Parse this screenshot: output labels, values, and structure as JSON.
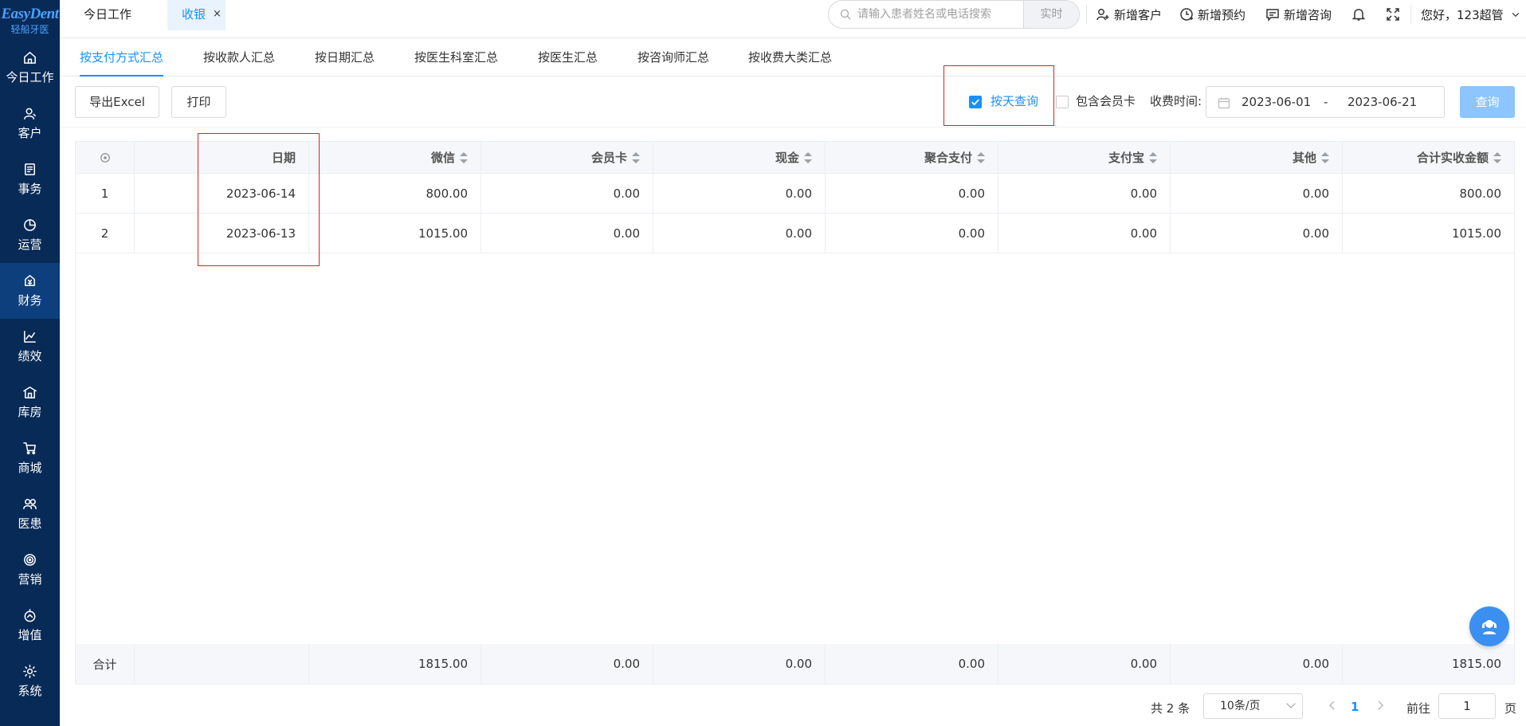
{
  "logo": {
    "main": "EasyDent",
    "sub": "轻船牙医"
  },
  "sidebar": {
    "items": [
      {
        "label": "今日工作",
        "icon": "home-icon"
      },
      {
        "label": "客户",
        "icon": "user-icon"
      },
      {
        "label": "事务",
        "icon": "clipboard-icon"
      },
      {
        "label": "运营",
        "icon": "pie-chart-icon"
      },
      {
        "label": "财务",
        "icon": "finance-icon"
      },
      {
        "label": "绩效",
        "icon": "line-chart-icon"
      },
      {
        "label": "库房",
        "icon": "warehouse-icon"
      },
      {
        "label": "商城",
        "icon": "cart-icon"
      },
      {
        "label": "医患",
        "icon": "people-icon"
      },
      {
        "label": "营销",
        "icon": "target-icon"
      },
      {
        "label": "增值",
        "icon": "growth-icon"
      },
      {
        "label": "系统",
        "icon": "gear-icon"
      }
    ],
    "active_index": 4
  },
  "topbar": {
    "tab_today": "今日工作",
    "tab_cash": "收银",
    "tab_close": "×",
    "search_placeholder": "请输入患者姓名或电话搜索",
    "realtime": "实时",
    "new_customer": "新增客户",
    "new_appointment": "新增预约",
    "new_consult": "新增咨询",
    "greeting": "您好，123超管"
  },
  "summary_tabs": [
    "按支付方式汇总",
    "按收款人汇总",
    "按日期汇总",
    "按医生科室汇总",
    "按医生汇总",
    "按咨询师汇总",
    "按收费大类汇总"
  ],
  "toolbar": {
    "export": "导出Excel",
    "print": "打印",
    "by_day": "按天查询",
    "by_day_checked": true,
    "include_member": "包含会员卡",
    "include_member_checked": false,
    "time_label": "收费时间:",
    "date_start": "2023-06-01",
    "date_sep": "-",
    "date_end": "2023-06-21",
    "query": "查询"
  },
  "table": {
    "columns": [
      "日期",
      "微信",
      "会员卡",
      "现金",
      "聚合支付",
      "支付宝",
      "其他",
      "合计实收金额"
    ],
    "rows": [
      {
        "idx": "1",
        "date": "2023-06-14",
        "wechat": "800.00",
        "member": "0.00",
        "cash": "0.00",
        "agg": "0.00",
        "alipay": "0.00",
        "other": "0.00",
        "total": "800.00"
      },
      {
        "idx": "2",
        "date": "2023-06-13",
        "wechat": "1015.00",
        "member": "0.00",
        "cash": "0.00",
        "agg": "0.00",
        "alipay": "0.00",
        "other": "0.00",
        "total": "1015.00"
      }
    ],
    "footer": {
      "label": "合计",
      "wechat": "1815.00",
      "member": "0.00",
      "cash": "0.00",
      "agg": "0.00",
      "alipay": "0.00",
      "other": "0.00",
      "total": "1815.00"
    }
  },
  "pagination": {
    "total": "共 2 条",
    "page_size": "10条/页",
    "current": "1",
    "goto_label": "前往",
    "goto_value": "1",
    "page_suffix": "页"
  },
  "colors": {
    "sidebar_bg": "#082a57",
    "accent": "#1890ff",
    "highlight_box": "#e02020"
  }
}
